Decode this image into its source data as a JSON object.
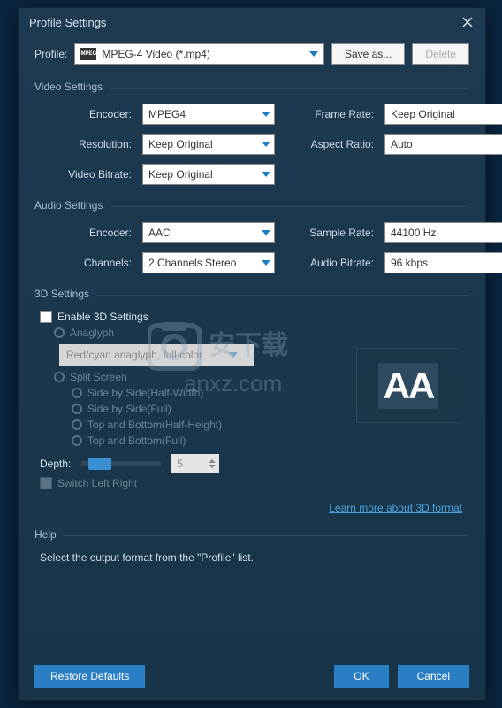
{
  "window": {
    "title": "Profile Settings"
  },
  "profile": {
    "label": "Profile:",
    "icon_text": "MPEG",
    "value": "MPEG-4 Video (*.mp4)",
    "save_as": "Save as...",
    "delete": "Delete"
  },
  "video": {
    "section_title": "Video Settings",
    "encoder_label": "Encoder:",
    "encoder_value": "MPEG4",
    "resolution_label": "Resolution:",
    "resolution_value": "Keep Original",
    "bitrate_label": "Video Bitrate:",
    "bitrate_value": "Keep Original",
    "framerate_label": "Frame Rate:",
    "framerate_value": "Keep Original",
    "aspect_label": "Aspect Ratio:",
    "aspect_value": "Auto"
  },
  "audio": {
    "section_title": "Audio Settings",
    "encoder_label": "Encoder:",
    "encoder_value": "AAC",
    "channels_label": "Channels:",
    "channels_value": "2 Channels Stereo",
    "samplerate_label": "Sample Rate:",
    "samplerate_value": "44100 Hz",
    "bitrate_label": "Audio Bitrate:",
    "bitrate_value": "96 kbps"
  },
  "three_d": {
    "section_title": "3D Settings",
    "enable_label": "Enable 3D Settings",
    "anaglyph_label": "Anaglyph",
    "anaglyph_value": "Red/cyan anaglyph, full color",
    "split_label": "Split Screen",
    "side_half": "Side by Side(Half-Width)",
    "side_full": "Side by Side(Full)",
    "top_half": "Top and Bottom(Half-Height)",
    "top_full": "Top and Bottom(Full)",
    "depth_label": "Depth:",
    "depth_value": "5",
    "switch_label": "Switch Left Right",
    "learn_more": "Learn more about 3D format",
    "preview_text": "AA"
  },
  "help": {
    "section_title": "Help",
    "text": "Select the output format from the \"Profile\" list."
  },
  "footer": {
    "restore": "Restore Defaults",
    "ok": "OK",
    "cancel": "Cancel"
  },
  "watermark": {
    "text1": "安下载",
    "text2": "anxz.com"
  }
}
